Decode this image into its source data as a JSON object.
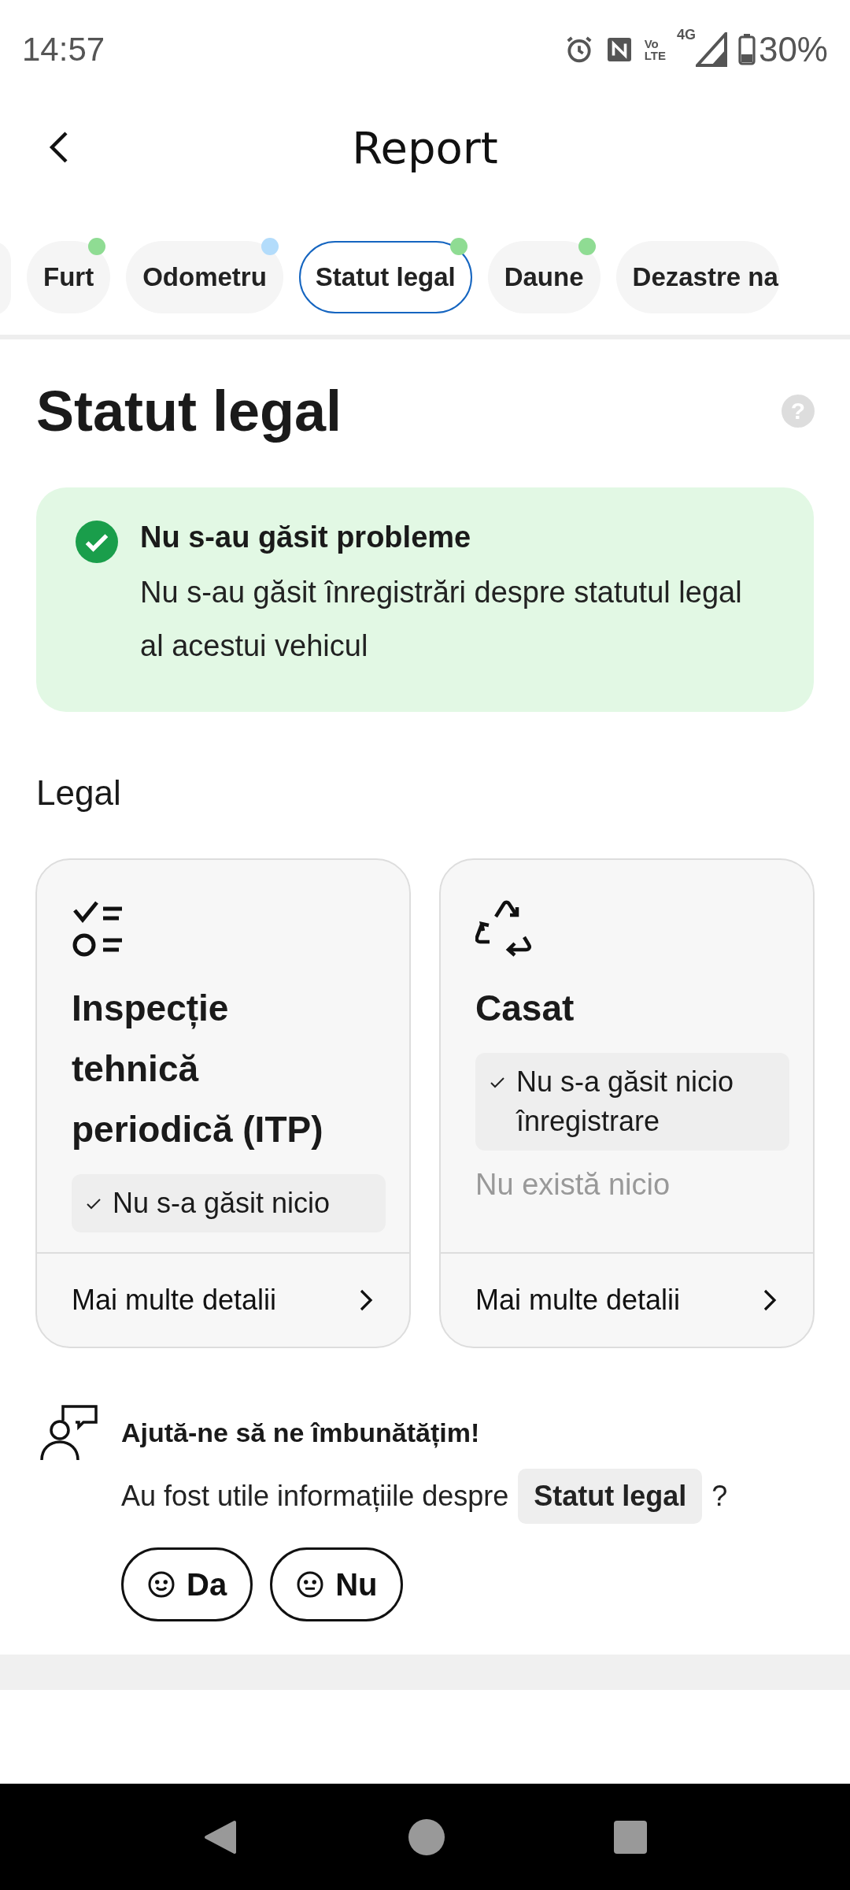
{
  "status_bar": {
    "time": "14:57",
    "volte_top": "Vo",
    "volte_bottom": "LTE",
    "network": "4G",
    "battery": "30%"
  },
  "header": {
    "title": "Report"
  },
  "tabs": [
    {
      "label": "Furt",
      "selected": false,
      "color": "#8fdc93"
    },
    {
      "label": "Odometru",
      "selected": false,
      "color": "#b3dcfb"
    },
    {
      "label": "Statut legal",
      "selected": true,
      "color": "#8fdc93"
    },
    {
      "label": "Daune",
      "selected": false,
      "color": "#8fdc93"
    },
    {
      "label": "Dezastre na",
      "selected": false
    }
  ],
  "section": {
    "title": "Statut legal",
    "help": "?"
  },
  "alert": {
    "kind": "success",
    "title": "Nu s-au găsit probleme",
    "message": "Nu s-au găsit înregistrări despre statutul legal al acestui vehicul"
  },
  "legal": {
    "title": "Legal",
    "cards": [
      {
        "kind": "inspection",
        "title": "Inspecție tehnică periodică (ITP)",
        "status": "Nu s-a găsit nicio",
        "link": "Mai multe detalii"
      },
      {
        "kind": "scrapped",
        "title": "Casat",
        "status": "Nu s-a găsit nicio înregistrare",
        "description": "Nu există nicio",
        "link": "Mai multe detalii"
      }
    ]
  },
  "feedback": {
    "title": "Ajută-ne să ne îmbunătățim!",
    "question": "Au fost utile informațiile despre",
    "topic": "Statut legal",
    "question_end": "?",
    "buttons": [
      {
        "kind": "yes",
        "label": "Da"
      },
      {
        "kind": "no",
        "label": "Nu"
      }
    ]
  }
}
